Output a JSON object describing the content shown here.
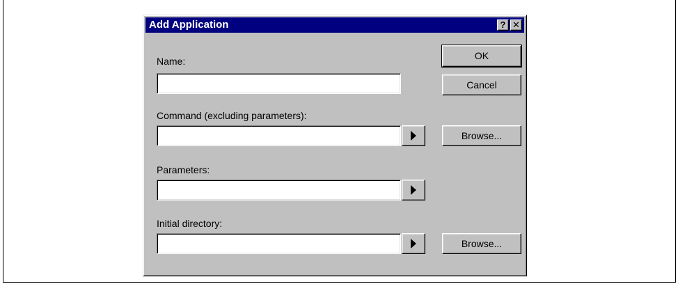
{
  "dialog": {
    "title": "Add Application",
    "help_glyph": "?",
    "close_glyph": "✕"
  },
  "labels": {
    "name": "Name:",
    "command": "Command (excluding parameters):",
    "parameters": "Parameters:",
    "initial_directory": "Initial directory:"
  },
  "fields": {
    "name_value": "",
    "command_value": "",
    "parameters_value": "",
    "initial_directory_value": ""
  },
  "buttons": {
    "ok": "OK",
    "cancel": "Cancel",
    "browse_command": "Browse...",
    "browse_directory": "Browse..."
  },
  "icons": {
    "dropdown_arrow": "right-arrow-icon",
    "help": "help-icon",
    "close": "close-icon"
  }
}
